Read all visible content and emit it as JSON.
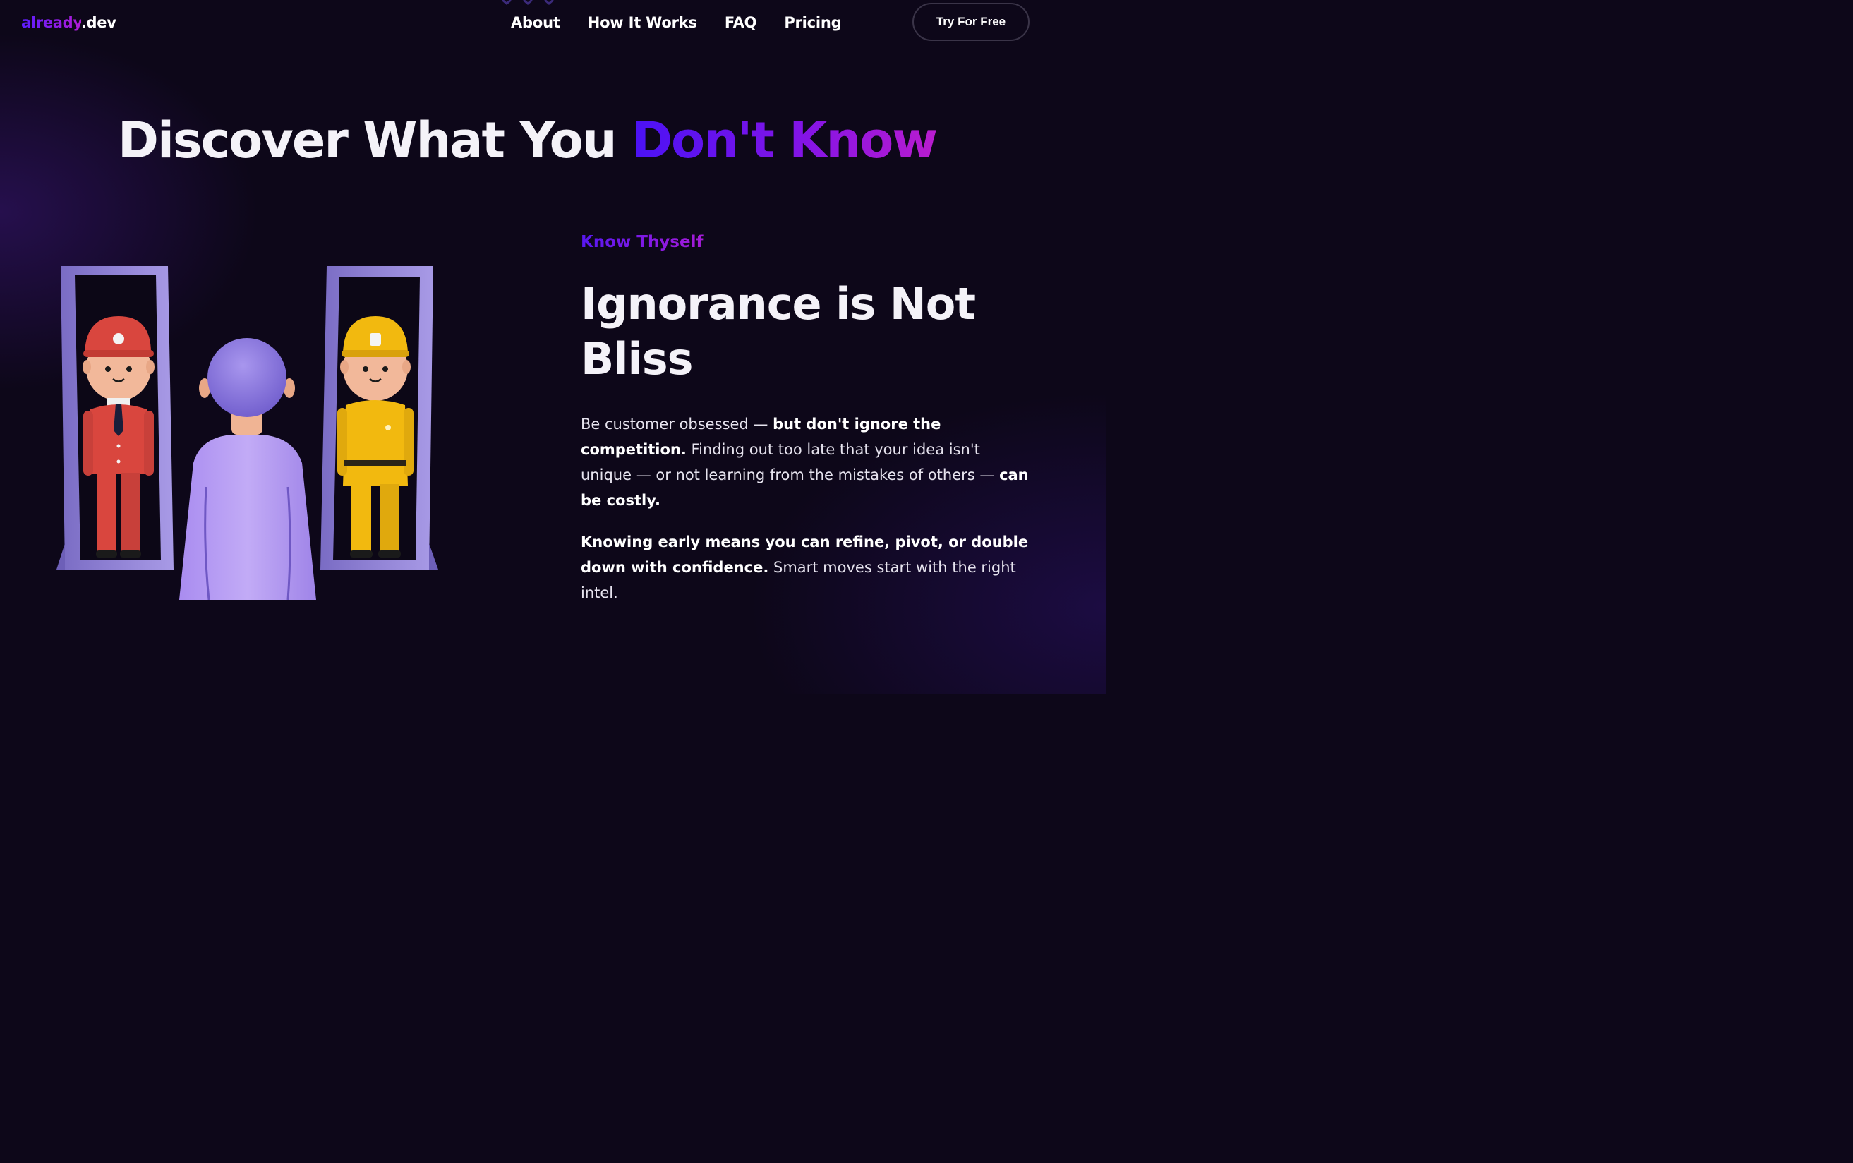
{
  "nav": {
    "logo_brand": "already",
    "logo_tld": ".dev",
    "links": [
      {
        "label": "About"
      },
      {
        "label": "How It Works"
      },
      {
        "label": "FAQ"
      },
      {
        "label": "Pricing"
      }
    ],
    "cta_label": "Try For Free"
  },
  "hero": {
    "title_plain": "Discover What You ",
    "title_highlight": "Don't Know"
  },
  "section": {
    "eyebrow": "Know Thyself",
    "title": "Ignorance is Not Bliss",
    "p1": [
      {
        "text": "Be customer obsessed — ",
        "bold": false
      },
      {
        "text": "but don't ignore the competition.",
        "bold": true
      },
      {
        "text": " Finding out too late that your idea isn't unique — or not learning from the mistakes of others — ",
        "bold": false
      },
      {
        "text": "can be costly.",
        "bold": true
      }
    ],
    "p2": [
      {
        "text": "Knowing early means you can refine, pivot, or double down with confidence.",
        "bold": true
      },
      {
        "text": " Smart moves start with the right intel.",
        "bold": false
      }
    ]
  },
  "illustration": {
    "icons": [
      "mirror-left",
      "mirror-right",
      "red-suit-figure",
      "yellow-firefighter-figure",
      "purple-person-back"
    ],
    "colors": {
      "mirror_frame": "#8f82d4",
      "red_figure": "#d9463e",
      "yellow_figure": "#f2b90f",
      "purple_person": "#b59cf2"
    }
  },
  "colors": {
    "background": "#0d0719",
    "accent_start": "#4a12f5",
    "accent_end": "#b91ccf"
  }
}
